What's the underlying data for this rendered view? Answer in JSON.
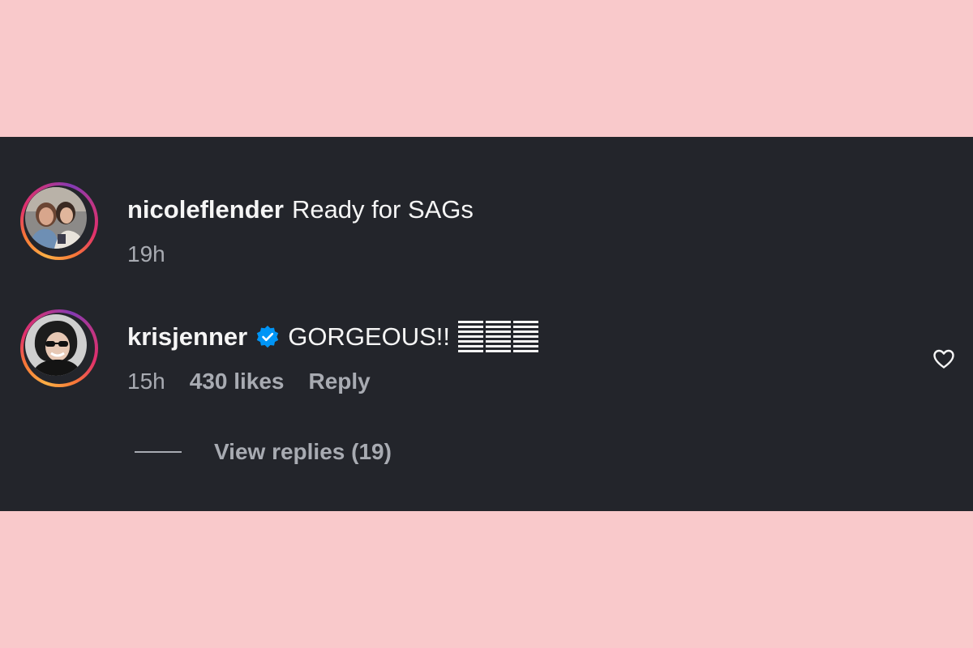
{
  "colors": {
    "page_background": "#f9c9cb",
    "panel_background": "#23252b",
    "primary_text": "#f5f5f5",
    "secondary_text": "#a8abb2",
    "verified_badge": "#0095f6",
    "story_ring": [
      "#fcaf45",
      "#f77737",
      "#e1306c",
      "#c13584",
      "#833ab4"
    ]
  },
  "comments": [
    {
      "username": "nicoleflender",
      "text": "Ready for SAGs",
      "time": "19h",
      "avatar_icon": "profile-photo-two-people"
    },
    {
      "username": "krisjenner",
      "verified": true,
      "verified_icon": "verified-badge-icon",
      "text": "GORGEOUS!!",
      "emoji_placeholders": 3,
      "time": "15h",
      "likes": "430 likes",
      "reply_label": "Reply",
      "like_icon": "heart-outline-icon",
      "avatar_icon": "profile-photo-sunglasses"
    }
  ],
  "view_replies": {
    "label": "View replies (19)"
  }
}
